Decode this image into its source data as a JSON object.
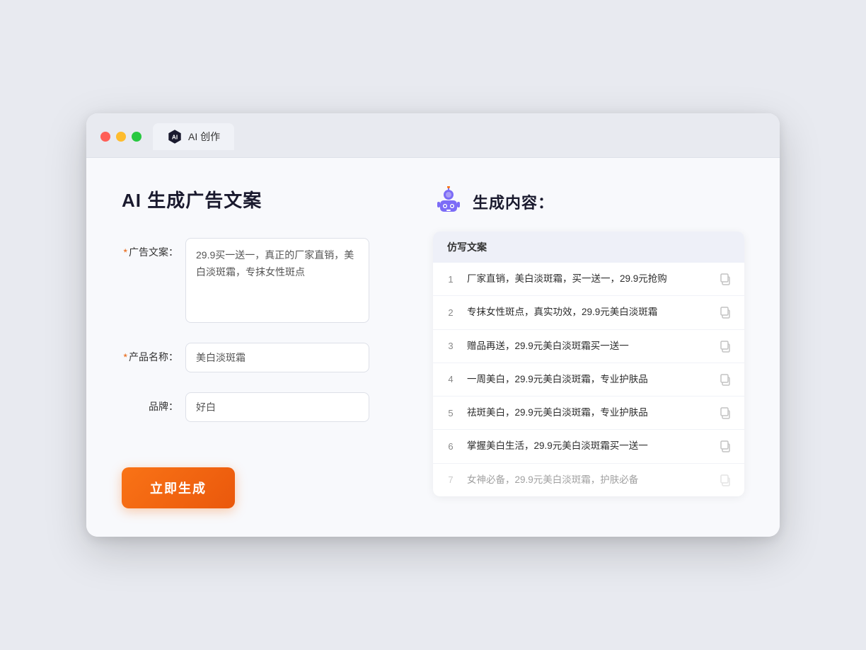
{
  "window": {
    "tab_label": "AI 创作"
  },
  "left_panel": {
    "page_title": "AI 生成广告文案",
    "ad_copy_label": "广告文案：",
    "ad_copy_required": true,
    "ad_copy_value": "29.9买一送一，真正的厂家直销，美白淡斑霜，专抹女性斑点",
    "product_name_label": "产品名称：",
    "product_name_required": true,
    "product_name_value": "美白淡斑霜",
    "brand_label": "品牌：",
    "brand_required": false,
    "brand_value": "好白",
    "generate_button_label": "立即生成"
  },
  "right_panel": {
    "result_title": "生成内容：",
    "column_label": "仿写文案",
    "results": [
      {
        "num": "1",
        "text": "厂家直销，美白淡斑霜，买一送一，29.9元抢购",
        "faded": false
      },
      {
        "num": "2",
        "text": "专抹女性斑点，真实功效，29.9元美白淡斑霜",
        "faded": false
      },
      {
        "num": "3",
        "text": "赠品再送，29.9元美白淡斑霜买一送一",
        "faded": false
      },
      {
        "num": "4",
        "text": "一周美白，29.9元美白淡斑霜，专业护肤品",
        "faded": false
      },
      {
        "num": "5",
        "text": "祛斑美白，29.9元美白淡斑霜，专业护肤品",
        "faded": false
      },
      {
        "num": "6",
        "text": "掌握美白生活，29.9元美白淡斑霜买一送一",
        "faded": false
      },
      {
        "num": "7",
        "text": "女神必备，29.9元美白淡斑霜，护肤必备",
        "faded": true
      }
    ]
  }
}
